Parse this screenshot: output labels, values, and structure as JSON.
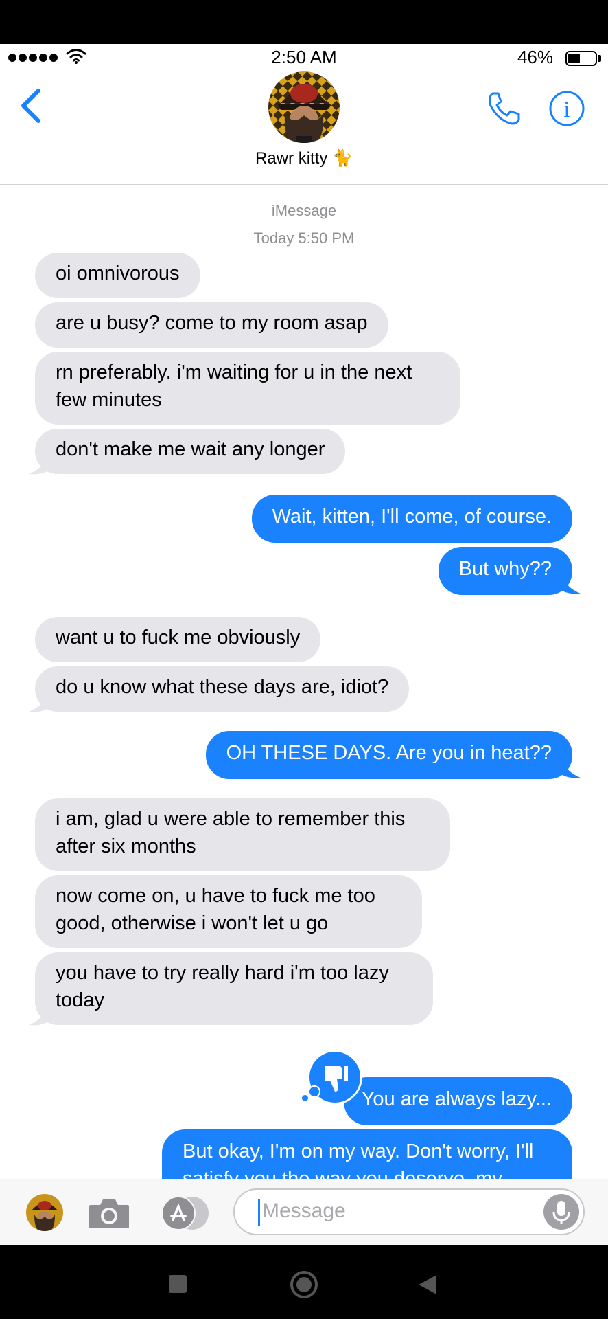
{
  "status_bar": {
    "time": "2:50 AM",
    "battery_percent": "46%",
    "battery_level": 0.46
  },
  "header": {
    "contact_name": "Rawr kitty 🐈"
  },
  "conversation": {
    "service_label": "iMessage",
    "timestamp": "Today 5:50 PM",
    "messages": [
      {
        "dir": "in",
        "text": "oi omnivorous"
      },
      {
        "dir": "in",
        "text": "are u busy? come to my room asap"
      },
      {
        "dir": "in",
        "text": "rn preferably. i'm waiting for u in the next few minutes"
      },
      {
        "dir": "in",
        "text": "don't make me wait any longer"
      },
      {
        "dir": "out",
        "text": "Wait, kitten, I'll come, of course."
      },
      {
        "dir": "out",
        "text": "But why??"
      },
      {
        "dir": "in",
        "text": "want u to fuck me obviously"
      },
      {
        "dir": "in",
        "text": "do u know what these days are, idiot?"
      },
      {
        "dir": "out",
        "text": "OH THESE DAYS. Are you in heat??"
      },
      {
        "dir": "in",
        "text": "i am, glad u were able to remember this after six months"
      },
      {
        "dir": "in",
        "text": "now come on, u have to fuck me too good, otherwise i won't let u go"
      },
      {
        "dir": "in",
        "text": "you have to try really hard i'm too lazy today"
      },
      {
        "dir": "out",
        "text": "You are always lazy..."
      },
      {
        "dir": "out",
        "text": "But okay, I'm on my way. Don't worry, I'll satisfy you the way you deserve, my"
      }
    ],
    "tapback_icon": "thumbs-down-icon"
  },
  "input": {
    "placeholder": "Message"
  },
  "colors": {
    "outgoing": "#1982fc",
    "incoming": "#e5e5ea",
    "accent": "#1982fc"
  }
}
